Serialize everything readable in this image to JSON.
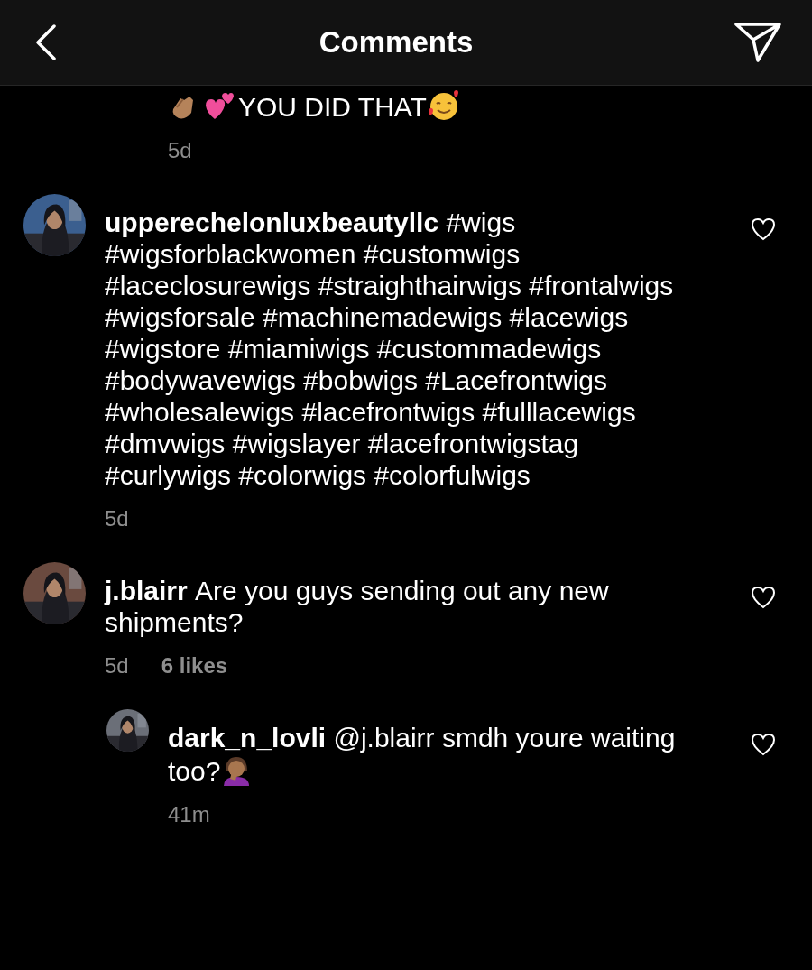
{
  "header": {
    "title": "Comments"
  },
  "comments": [
    {
      "kind": "cut",
      "leading_icons": [
        {
          "kind": "clap"
        },
        {
          "kind": "hearts"
        }
      ],
      "text": "YOU DID THAT",
      "trailing_icons": [
        {
          "kind": "smile"
        }
      ],
      "time": "5d"
    },
    {
      "kind": "comment",
      "username": "upperechelonluxbeautyllc",
      "text": "#wigs #wigsforblackwomen #customwigs #laceclosurewigs #straighthairwigs #frontalwigs #wigsforsale #machinemadewigs #lacewigs #wigstore #miamiwigs #custommadewigs #bodywavewigs #bobwigs #Lacefrontwigs #wholesalewigs #lacefrontwigs #fulllacewigs #dmvwigs #wigslayer #lacefrontwigstag #curlywigs #colorwigs #colorfulwigs",
      "time": "5d"
    },
    {
      "kind": "comment",
      "username": "j.blairr",
      "text": "Are you guys sending out any new shipments?",
      "time": "5d",
      "likes": "6 likes"
    },
    {
      "kind": "reply",
      "username": "dark_n_lovli",
      "text": "@j.blairr smdh youre waiting too?",
      "trailing_icons": [
        {
          "kind": "facepalm"
        }
      ],
      "time": "41m"
    }
  ]
}
